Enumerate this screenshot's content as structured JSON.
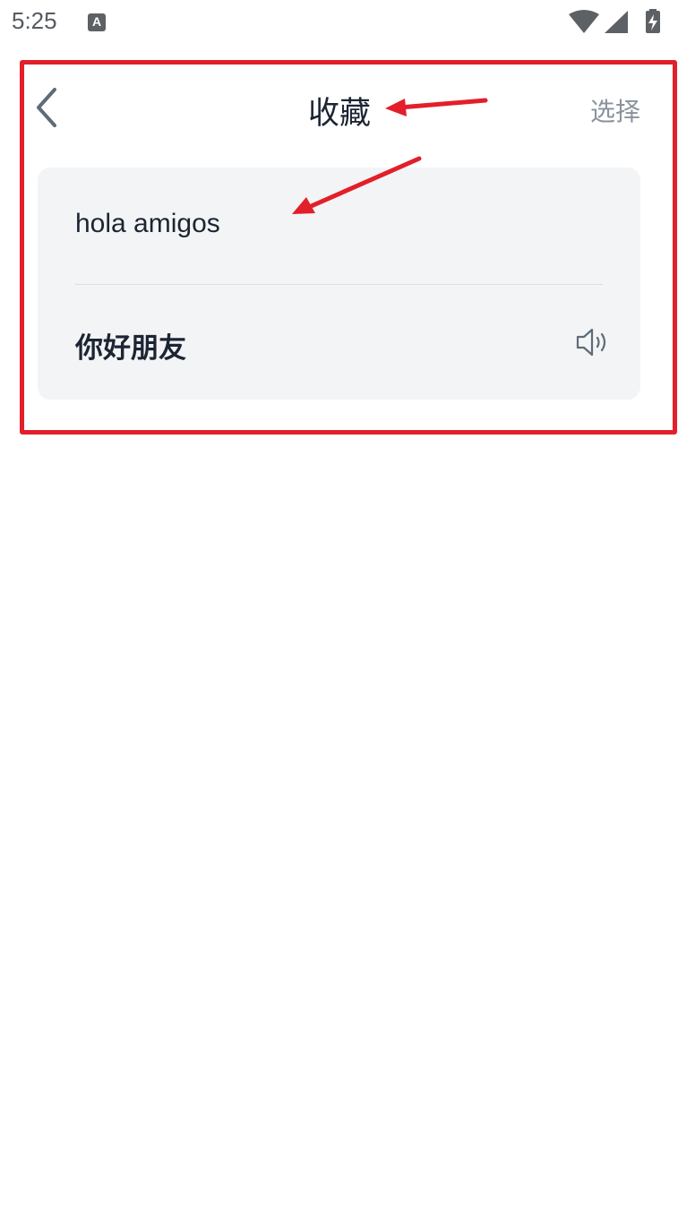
{
  "status_bar": {
    "time": "5:25",
    "app_icon_letter": "A",
    "icons": [
      "wifi-icon",
      "signal-icon",
      "battery-charging-icon"
    ]
  },
  "header": {
    "title": "收藏",
    "select_label": "选择",
    "back_icon": "chevron-left-icon"
  },
  "favorites": [
    {
      "source": "hola amigos",
      "translation": "你好朋友",
      "speaker_icon": "speaker-icon"
    }
  ],
  "colors": {
    "annotation": "#e21f2a",
    "card_background": "#f3f4f6",
    "title_text": "#1c2533",
    "muted_text": "#8a939c"
  }
}
